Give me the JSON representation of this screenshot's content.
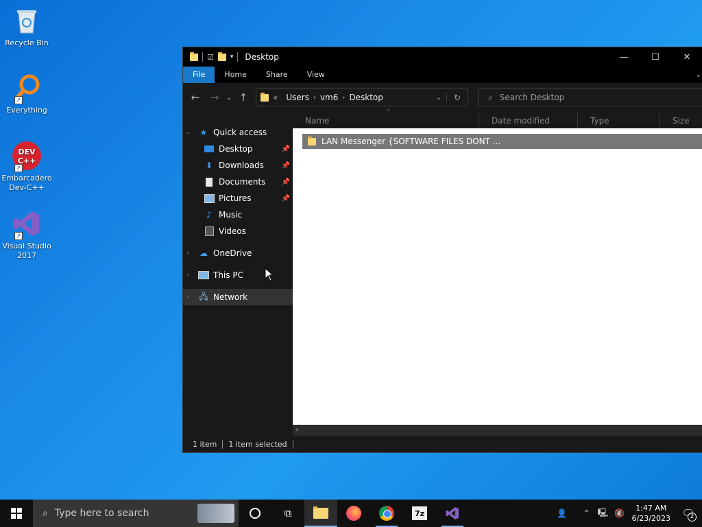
{
  "desktop": {
    "icons": [
      {
        "label": "Recycle Bin"
      },
      {
        "label": "Everything"
      },
      {
        "label": "Embarcadero Dev-C++"
      },
      {
        "label": "Visual Studio 2017"
      }
    ]
  },
  "window": {
    "title": "Desktop",
    "ribbon_tabs": [
      "File",
      "Home",
      "Share",
      "View"
    ],
    "address": {
      "prefix": "«",
      "crumbs": [
        "Users",
        "vm6",
        "Desktop"
      ]
    },
    "search_placeholder": "Search Desktop",
    "nav": {
      "quick_access": "Quick access",
      "quick_items": [
        "Desktop",
        "Downloads",
        "Documents",
        "Pictures",
        "Music",
        "Videos"
      ],
      "onedrive": "OneDrive",
      "this_pc": "This PC",
      "network": "Network"
    },
    "columns": [
      "Name",
      "Date modified",
      "Type",
      "Size"
    ],
    "files": [
      {
        "name": "LAN Messenger {SOFTWARE FILES DONT ..."
      }
    ],
    "status": {
      "count": "1 item",
      "selected": "1 item selected"
    }
  },
  "taskbar": {
    "search_placeholder": "Type here to search",
    "time": "1:47 AM",
    "date": "6/23/2023",
    "notification_count": "2"
  },
  "colors": {
    "accent": "#1979ca",
    "selected_row": "#777777"
  }
}
